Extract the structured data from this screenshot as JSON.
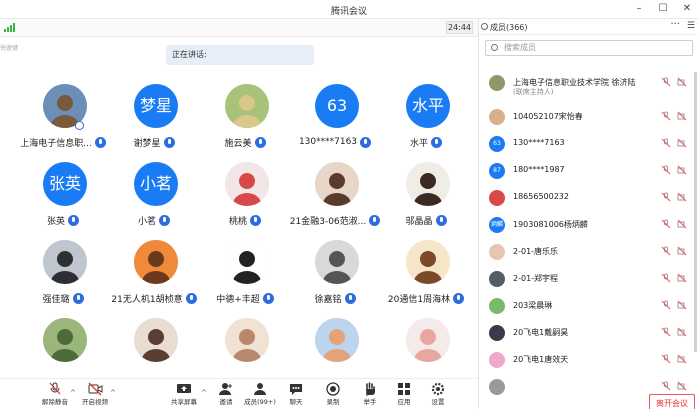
{
  "window": {
    "title": "腾讯会议"
  },
  "status": {
    "timer": "24:44",
    "side_mark": "快速键"
  },
  "speaking": {
    "label": "正在讲话:"
  },
  "participants": [
    {
      "name": "上海电子信息职...",
      "kind": "pic",
      "c1": "#6c8fb8",
      "c2": "#7a5a3a",
      "host": true
    },
    {
      "name": "谢梦星",
      "kind": "text",
      "avatar_text": "梦星"
    },
    {
      "name": "施云美",
      "kind": "pic",
      "c1": "#a8c27a",
      "c2": "#d9c88a"
    },
    {
      "name": "130****7163",
      "kind": "text",
      "avatar_text": "63"
    },
    {
      "name": "水平",
      "kind": "text",
      "avatar_text": "水平"
    },
    {
      "name": "张英",
      "kind": "text",
      "avatar_text": "张英"
    },
    {
      "name": "小茗",
      "kind": "text",
      "avatar_text": "小茗"
    },
    {
      "name": "桃桃",
      "kind": "pic",
      "c1": "#f2e7e7",
      "c2": "#d94848"
    },
    {
      "name": "21金融3-06范淑...",
      "kind": "pic",
      "c1": "#e8d6c8",
      "c2": "#5b3a2e"
    },
    {
      "name": "邬晶晶",
      "kind": "pic",
      "c1": "#f0ede6",
      "c2": "#3a2a22"
    },
    {
      "name": "强佳璐",
      "kind": "pic",
      "c1": "#bfc6cf",
      "c2": "#2e2f33"
    },
    {
      "name": "21无人机1胡桢意",
      "kind": "pic",
      "c1": "#f08a3a",
      "c2": "#6b3a1e"
    },
    {
      "name": "中德+丰超",
      "kind": "pic",
      "c1": "#ffffff",
      "c2": "#222222"
    },
    {
      "name": "徐嘉铭",
      "kind": "pic",
      "c1": "#d9d9d9",
      "c2": "#555555"
    },
    {
      "name": "20通信1周海林",
      "kind": "pic",
      "c1": "#f6e6c8",
      "c2": "#7a4a2a"
    },
    {
      "name": "",
      "kind": "pic",
      "c1": "#9bb67a",
      "c2": "#4c6a3a"
    },
    {
      "name": "",
      "kind": "pic",
      "c1": "#e9ddd2",
      "c2": "#5a3e32"
    },
    {
      "name": "",
      "kind": "pic",
      "c1": "#f2e2d4",
      "c2": "#b8886a"
    },
    {
      "name": "",
      "kind": "pic",
      "c1": "#bcd4ee",
      "c2": "#e4a27a"
    },
    {
      "name": "",
      "kind": "pic",
      "c1": "#f4eaea",
      "c2": "#e8a6a0"
    }
  ],
  "toolbar": {
    "unmute": "解除静音",
    "video": "开启视频",
    "share": "共享屏幕",
    "invite": "邀请",
    "members": "成员(99+)",
    "chat": "聊天",
    "record": "录制",
    "hand": "举手",
    "apps": "应用",
    "settings": "设置"
  },
  "sidebar": {
    "title": "成员(366)",
    "search_placeholder": "搜索成员",
    "members": [
      {
        "name": "上海电子信息职业技术学院   徐济陆",
        "sub": "(联席主持人)",
        "kind": "pic",
        "color": "#8c9a6a"
      },
      {
        "name": "104052107宋怡春",
        "kind": "pic",
        "color": "#d8b08c"
      },
      {
        "name": "130****7163",
        "kind": "text",
        "avatar_text": "63"
      },
      {
        "name": "180****1987",
        "kind": "text",
        "avatar_text": "87"
      },
      {
        "name": "18656500232",
        "kind": "pic",
        "color": "#d84a4a"
      },
      {
        "name": "1903081006杨炳麟",
        "kind": "text",
        "avatar_text": "炳麟"
      },
      {
        "name": "2-01-唐乐乐",
        "kind": "pic",
        "color": "#e6c6b0"
      },
      {
        "name": "2-01-郑宇程",
        "kind": "pic",
        "color": "#555c66"
      },
      {
        "name": "203梁晨琳",
        "kind": "pic",
        "color": "#7ab86a"
      },
      {
        "name": "20飞电1戴嗣昊",
        "kind": "pic",
        "color": "#3a3a4a"
      },
      {
        "name": "20飞电1唐效天",
        "kind": "pic",
        "color": "#f0a8c8"
      },
      {
        "name": "",
        "kind": "pic",
        "color": "#999999"
      }
    ],
    "leave": "离开会议"
  },
  "colors": {
    "accent": "#1a7cf5",
    "leave": "#e33333",
    "signal": "#3bb34a"
  }
}
